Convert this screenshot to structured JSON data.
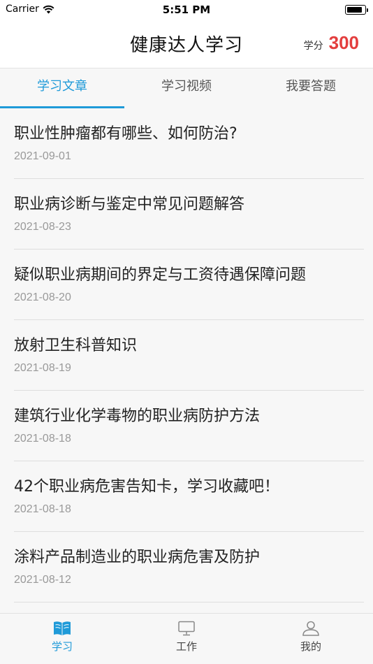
{
  "status_bar": {
    "carrier": "Carrier",
    "time": "5:51 PM"
  },
  "header": {
    "title": "健康达人学习",
    "score_label": "学分",
    "score_value": "300"
  },
  "tabs": [
    {
      "label": "学习文章",
      "active": true
    },
    {
      "label": "学习视频",
      "active": false
    },
    {
      "label": "我要答题",
      "active": false
    }
  ],
  "articles": [
    {
      "title": "职业性肿瘤都有哪些、如何防治?",
      "date": "2021-09-01"
    },
    {
      "title": "职业病诊断与鉴定中常见问题解答",
      "date": "2021-08-23"
    },
    {
      "title": "疑似职业病期间的界定与工资待遇保障问题",
      "date": "2021-08-20"
    },
    {
      "title": "放射卫生科普知识",
      "date": "2021-08-19"
    },
    {
      "title": "建筑行业化学毒物的职业病防护方法",
      "date": "2021-08-18"
    },
    {
      "title": "42个职业病危害告知卡，学习收藏吧！",
      "date": "2021-08-18"
    },
    {
      "title": "涂料产品制造业的职业病危害及防护",
      "date": "2021-08-12"
    }
  ],
  "tabbar": [
    {
      "label": "学习",
      "icon": "book-icon",
      "active": true
    },
    {
      "label": "工作",
      "icon": "monitor-icon",
      "active": false
    },
    {
      "label": "我的",
      "icon": "person-icon",
      "active": false
    }
  ],
  "colors": {
    "accent": "#1f9ad8",
    "score": "#e33e3e"
  }
}
